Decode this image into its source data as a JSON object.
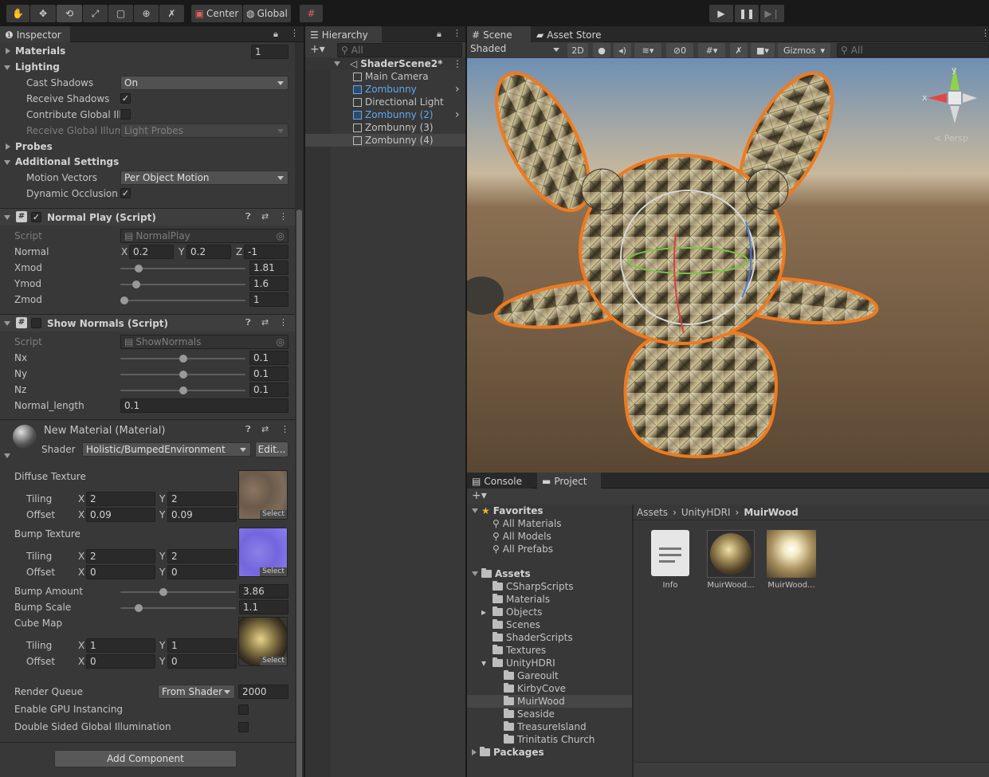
{
  "toolbar": {
    "center_label": "Center",
    "global_label": "Global"
  },
  "inspector": {
    "tab": "Inspector",
    "materials_label": "Materials",
    "materials_count": "1",
    "lighting_label": "Lighting",
    "cast_shadows_label": "Cast Shadows",
    "cast_shadows_value": "On",
    "receive_shadows_label": "Receive Shadows",
    "contribute_gi_label": "Contribute Global Illu",
    "receive_gi_label": "Receive Global Illumi",
    "receive_gi_value": "Light Probes",
    "probes_label": "Probes",
    "additional_label": "Additional Settings",
    "motion_vectors_label": "Motion Vectors",
    "motion_vectors_value": "Per Object Motion",
    "dynamic_occlusion_label": "Dynamic Occlusion",
    "normal_play": {
      "title": "Normal Play (Script)",
      "script_label": "Script",
      "script_value": "NormalPlay",
      "normal_label": "Normal",
      "x_label": "X",
      "x": "0.2",
      "y_label": "Y",
      "y": "0.2",
      "z_label": "Z",
      "z": "-1",
      "xmod_label": "Xmod",
      "xmod": "1.81",
      "ymod_label": "Ymod",
      "ymod": "1.6",
      "zmod_label": "Zmod",
      "zmod": "1"
    },
    "show_normals": {
      "title": "Show Normals (Script)",
      "script_label": "Script",
      "script_value": "ShowNormals",
      "nx_label": "Nx",
      "nx": "0.1",
      "ny_label": "Ny",
      "ny": "0.1",
      "nz_label": "Nz",
      "nz": "0.1",
      "length_label": "Normal_length",
      "length": "0.1"
    },
    "material": {
      "title": "New Material (Material)",
      "shader_label": "Shader",
      "shader_value": "Holistic/BumpedEnvironment",
      "edit_label": "Edit...",
      "diffuse_label": "Diffuse Texture",
      "tiling_label": "Tiling",
      "offset_label": "Offset",
      "x_label": "X",
      "y_label": "Y",
      "diffuse_tiling_x": "2",
      "diffuse_tiling_y": "2",
      "diffuse_offset_x": "0.09",
      "diffuse_offset_y": "0.09",
      "bump_label": "Bump Texture",
      "bump_tiling_x": "2",
      "bump_tiling_y": "2",
      "bump_offset_x": "0",
      "bump_offset_y": "0",
      "bump_amount_label": "Bump Amount",
      "bump_amount": "3.86",
      "bump_scale_label": "Bump Scale",
      "bump_scale": "1.1",
      "cubemap_label": "Cube Map",
      "cube_tiling_x": "1",
      "cube_tiling_y": "1",
      "cube_offset_x": "0",
      "cube_offset_y": "0",
      "select_label": "Select",
      "render_queue_label": "Render Queue",
      "render_queue_mode": "From Shader",
      "render_queue_value": "2000",
      "gpu_instancing_label": "Enable GPU Instancing",
      "double_sided_label": "Double Sided Global Illumination"
    },
    "add_component_label": "Add Component",
    "slider_levels": {
      "xmod": 0.12,
      "ymod": 0.1,
      "zmod": 0.0,
      "nx": 0.5,
      "ny": 0.5,
      "nz": 0.5,
      "bump_amount": 0.36,
      "bump_scale": 0.13
    }
  },
  "hierarchy": {
    "tab": "Hierarchy",
    "search_placeholder": "All",
    "scene_name": "ShaderScene2*",
    "items": [
      {
        "label": "Main Camera",
        "prefab": false
      },
      {
        "label": "Zombunny",
        "prefab": true
      },
      {
        "label": "Directional Light",
        "prefab": false
      },
      {
        "label": "Zombunny (2)",
        "prefab": true
      },
      {
        "label": "Zombunny (3)",
        "prefab": false
      },
      {
        "label": "Zombunny (4)",
        "prefab": false
      }
    ]
  },
  "scene": {
    "tab_scene": "Scene",
    "tab_asset_store": "Asset Store",
    "shading_mode": "Shaded",
    "mode_2d": "2D",
    "hidden_count": "0",
    "gizmos_label": "Gizmos",
    "search_placeholder": "All",
    "persp_label": "< Persp",
    "axis_y": "y",
    "axis_x": "x"
  },
  "project": {
    "tab_console": "Console",
    "tab_project": "Project",
    "favorites_label": "Favorites",
    "favorites": [
      "All Materials",
      "All Models",
      "All Prefabs"
    ],
    "assets_label": "Assets",
    "asset_folders": [
      "CSharpScripts",
      "Materials",
      "Objects",
      "Scenes",
      "ShaderScripts",
      "Textures",
      "UnityHDRI"
    ],
    "hdri_folders": [
      "Gareoult",
      "KirbyCove",
      "MuirWood",
      "Seaside",
      "TreasureIsland",
      "Trinitatis Church"
    ],
    "packages_label": "Packages",
    "breadcrumb": [
      "Assets",
      "UnityHDRI",
      "MuirWood"
    ],
    "grid_items": [
      "Info",
      "MuirWood...",
      "MuirWood..."
    ]
  },
  "colors": {
    "accent_blue": "#5fa8f0",
    "selection_outline": "#f07a1e",
    "panel_bg": "#383838"
  }
}
